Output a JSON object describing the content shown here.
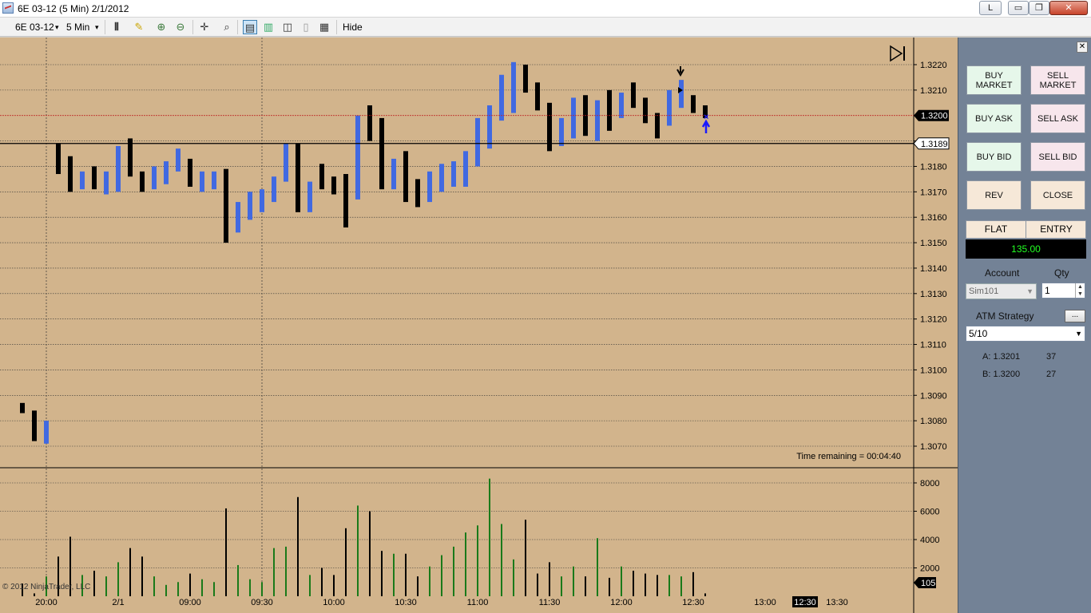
{
  "window": {
    "title": "6E 03-12 (5 Min)  2/1/2012",
    "lock_label": "L",
    "min_label": "▭",
    "max_label": "❐",
    "close_label": "✕"
  },
  "toolbar": {
    "instrument": "6E 03-12",
    "interval": "5 Min",
    "dropdown_glyph": "▾",
    "hide_label": "Hide"
  },
  "icons": {
    "bar-type-icon": "bar-type-icon",
    "pencil-icon": "pencil-icon",
    "zoom-in-icon": "zoom-in-icon",
    "zoom-out-icon": "zoom-out-icon",
    "crosshair-icon": "crosshair-icon",
    "magnifier-icon": "magnifier-icon",
    "chart-trader-icon": "chart-trader-icon",
    "indicators-icon": "indicators-icon",
    "strategies-icon": "strategies-icon",
    "copy-icon": "copy-icon",
    "properties-icon": "properties-icon",
    "skip-to-end-icon": "skip-to-end-icon"
  },
  "colors": {
    "chart_bg": "#d2b48c",
    "up_bar": "#4169e1",
    "down_bar": "#000000",
    "volume_up": "#1a7a1a",
    "volume_down": "#000000",
    "panel_bg": "#738296"
  },
  "chart_data": {
    "type": "ohlc-bar",
    "price_axis": {
      "ticks": [
        "1.3220",
        "1.3210",
        "1.3200",
        "1.3190",
        "1.3180",
        "1.3170",
        "1.3160",
        "1.3150",
        "1.3140",
        "1.3130",
        "1.3120",
        "1.3110",
        "1.3100",
        "1.3090",
        "1.3080",
        "1.3070"
      ],
      "ylim": [
        1.3065,
        1.3228
      ],
      "last_price": "1.3200",
      "marker_price": "1.3189"
    },
    "volume_axis": {
      "ticks": [
        "8000",
        "6000",
        "4000",
        "2000"
      ],
      "ylim": [
        0,
        9000
      ],
      "current_volume": "105"
    },
    "time_axis": {
      "ticks": [
        "20:00",
        "2/1",
        "09:00",
        "09:30",
        "10:00",
        "10:30",
        "11:00",
        "11:30",
        "12:00",
        "12:30",
        "13:00",
        "13:30"
      ],
      "current_time": "12:30"
    },
    "time_remaining": "Time remaining = 00:04:40",
    "copyright": "© 2012 NinjaTrader, LLC",
    "bars": [
      {
        "h": 1.3087,
        "l": 1.3083,
        "up": false
      },
      {
        "h": 1.3084,
        "l": 1.3072,
        "up": false
      },
      {
        "h": 1.308,
        "l": 1.3071,
        "up": true
      },
      {
        "h": 1.3189,
        "l": 1.3177,
        "up": false
      },
      {
        "h": 1.3184,
        "l": 1.317,
        "up": false
      },
      {
        "h": 1.3178,
        "l": 1.3171,
        "up": true
      },
      {
        "h": 1.318,
        "l": 1.3171,
        "up": false
      },
      {
        "h": 1.3178,
        "l": 1.3169,
        "up": true
      },
      {
        "h": 1.3188,
        "l": 1.317,
        "up": true
      },
      {
        "h": 1.3191,
        "l": 1.3176,
        "up": false
      },
      {
        "h": 1.3178,
        "l": 1.317,
        "up": false
      },
      {
        "h": 1.318,
        "l": 1.3171,
        "up": true
      },
      {
        "h": 1.3182,
        "l": 1.3173,
        "up": true
      },
      {
        "h": 1.3187,
        "l": 1.3178,
        "up": true
      },
      {
        "h": 1.3183,
        "l": 1.3172,
        "up": false
      },
      {
        "h": 1.3178,
        "l": 1.317,
        "up": true
      },
      {
        "h": 1.3178,
        "l": 1.3171,
        "up": true
      },
      {
        "h": 1.3179,
        "l": 1.315,
        "up": false
      },
      {
        "h": 1.3166,
        "l": 1.3154,
        "up": true
      },
      {
        "h": 1.317,
        "l": 1.3159,
        "up": true
      },
      {
        "h": 1.3171,
        "l": 1.3162,
        "up": true
      },
      {
        "h": 1.3176,
        "l": 1.3166,
        "up": true
      },
      {
        "h": 1.3189,
        "l": 1.3174,
        "up": true
      },
      {
        "h": 1.3189,
        "l": 1.3162,
        "up": false
      },
      {
        "h": 1.3174,
        "l": 1.3162,
        "up": true
      },
      {
        "h": 1.3181,
        "l": 1.3171,
        "up": false
      },
      {
        "h": 1.3176,
        "l": 1.3169,
        "up": false
      },
      {
        "h": 1.3177,
        "l": 1.3156,
        "up": false
      },
      {
        "h": 1.32,
        "l": 1.3167,
        "up": true
      },
      {
        "h": 1.3204,
        "l": 1.319,
        "up": false
      },
      {
        "h": 1.3199,
        "l": 1.3171,
        "up": false
      },
      {
        "h": 1.3183,
        "l": 1.3171,
        "up": true
      },
      {
        "h": 1.3186,
        "l": 1.3166,
        "up": false
      },
      {
        "h": 1.3175,
        "l": 1.3164,
        "up": false
      },
      {
        "h": 1.3178,
        "l": 1.3166,
        "up": true
      },
      {
        "h": 1.3181,
        "l": 1.317,
        "up": true
      },
      {
        "h": 1.3182,
        "l": 1.3172,
        "up": true
      },
      {
        "h": 1.3186,
        "l": 1.3172,
        "up": true
      },
      {
        "h": 1.3199,
        "l": 1.318,
        "up": true
      },
      {
        "h": 1.3204,
        "l": 1.3187,
        "up": true
      },
      {
        "h": 1.3216,
        "l": 1.3198,
        "up": true
      },
      {
        "h": 1.3221,
        "l": 1.3201,
        "up": true
      },
      {
        "h": 1.322,
        "l": 1.3209,
        "up": false
      },
      {
        "h": 1.3213,
        "l": 1.3202,
        "up": false
      },
      {
        "h": 1.3205,
        "l": 1.3186,
        "up": false
      },
      {
        "h": 1.3199,
        "l": 1.3188,
        "up": true
      },
      {
        "h": 1.3207,
        "l": 1.3191,
        "up": true
      },
      {
        "h": 1.3208,
        "l": 1.3192,
        "up": false
      },
      {
        "h": 1.3206,
        "l": 1.319,
        "up": true
      },
      {
        "h": 1.321,
        "l": 1.3194,
        "up": false
      },
      {
        "h": 1.3209,
        "l": 1.3199,
        "up": true
      },
      {
        "h": 1.3213,
        "l": 1.3203,
        "up": false
      },
      {
        "h": 1.3207,
        "l": 1.3197,
        "up": false
      },
      {
        "h": 1.3201,
        "l": 1.3191,
        "up": false
      },
      {
        "h": 1.321,
        "l": 1.3196,
        "up": true
      },
      {
        "h": 1.3214,
        "l": 1.3203,
        "up": true
      },
      {
        "h": 1.3208,
        "l": 1.3201,
        "up": false
      },
      {
        "h": 1.3204,
        "l": 1.3199,
        "up": false
      }
    ],
    "volumes": [
      900,
      200,
      1400,
      2800,
      4200,
      1500,
      1800,
      1400,
      2400,
      3400,
      2800,
      1400,
      800,
      1000,
      1600,
      1200,
      1000,
      6200,
      2200,
      1200,
      1000,
      3400,
      3500,
      7000,
      1500,
      2000,
      1500,
      4800,
      6400,
      6000,
      3200,
      3000,
      3000,
      1400,
      2100,
      2900,
      3500,
      4500,
      5000,
      8300,
      5100,
      2600,
      5400,
      1600,
      2400,
      1400,
      2100,
      1400,
      4100,
      1300,
      2100,
      1800,
      1600,
      1500,
      1500,
      1400,
      1700,
      200
    ],
    "markers": [
      {
        "type": "sell-arrow",
        "bar": 55
      },
      {
        "type": "buy-arrow",
        "bar": 57
      }
    ]
  },
  "panel": {
    "close_label": "✕",
    "buy_market": "BUY MARKET",
    "sell_market": "SELL MARKET",
    "buy_ask": "BUY ASK",
    "sell_ask": "SELL ASK",
    "buy_bid": "BUY BID",
    "sell_bid": "SELL BID",
    "rev": "REV",
    "close": "CLOSE",
    "position": "FLAT",
    "entry_label": "ENTRY",
    "pnl": "135.00",
    "account_label": "Account",
    "qty_label": "Qty",
    "account_value": "Sim101",
    "qty_value": "1",
    "atm_label": "ATM Strategy",
    "atm_more": "...",
    "atm_value": "5/10",
    "ask_label": "A: 1.3201",
    "ask_size": "37",
    "bid_label": "B: 1.3200",
    "bid_size": "27"
  }
}
